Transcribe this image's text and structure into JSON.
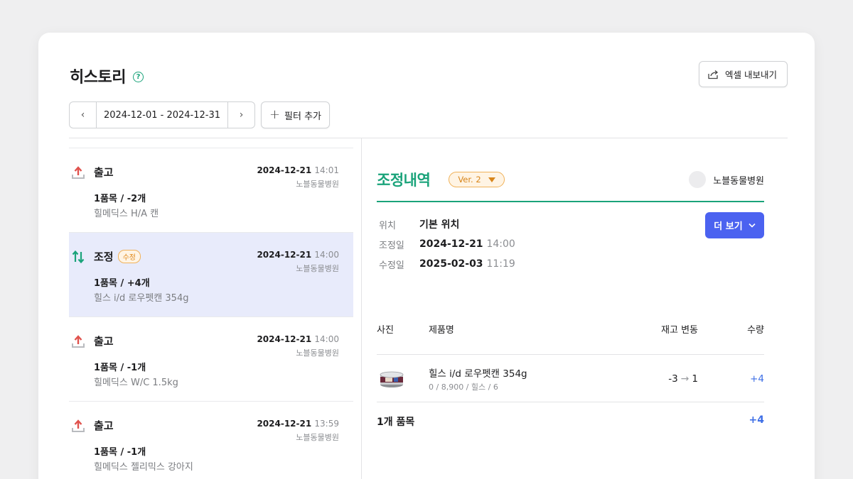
{
  "page": {
    "title": "히스토리",
    "export_label": "엑셀 내보내기",
    "date_range": "2024-12-01 - 2024-12-31",
    "filter_label": "필터 추가"
  },
  "history": [
    {
      "type": "출고",
      "kind": "out",
      "badge": "",
      "date": "2024-12-21",
      "time": "14:01",
      "place": "노블동물병원",
      "count": "1품목 / -2개",
      "product": "힐메딕스 H/A 캔",
      "selected": false
    },
    {
      "type": "조정",
      "kind": "adjust",
      "badge": "수정",
      "date": "2024-12-21",
      "time": "14:00",
      "place": "노블동물병원",
      "count": "1품목 / +4개",
      "product": "힐스 i/d 로우펫캔 354g",
      "selected": true
    },
    {
      "type": "출고",
      "kind": "out",
      "badge": "",
      "date": "2024-12-21",
      "time": "14:00",
      "place": "노블동물병원",
      "count": "1품목 / -1개",
      "product": "힐메딕스 W/C 1.5kg",
      "selected": false
    },
    {
      "type": "출고",
      "kind": "out",
      "badge": "",
      "date": "2024-12-21",
      "time": "13:59",
      "place": "노블동물병원",
      "count": "1품목 / -1개",
      "product": "힐메딕스 젤리믹스 강아지",
      "selected": false
    }
  ],
  "detail": {
    "title": "조정내역",
    "version": "Ver. 2",
    "hospital": "노블동물병원",
    "more_label": "더 보기",
    "location_label": "위치",
    "location": "기본 위치",
    "adjusted_label": "조정일",
    "adjusted_date": "2024-12-21",
    "adjusted_time": "14:00",
    "modified_label": "수정일",
    "modified_date": "2025-02-03",
    "modified_time": "11:19",
    "table_headers": {
      "photo": "사진",
      "name": "제품명",
      "stock": "재고 변동",
      "qty": "수량"
    },
    "rows": [
      {
        "name": "힐스 i/d 로우펫캔 354g",
        "sub": "0 / 8,900 / 힐스 / 6",
        "stock_from": "-3",
        "stock_to": "1",
        "qty": "+4"
      }
    ],
    "total_label": "1개 품목",
    "total_qty": "+4"
  },
  "icons": {
    "help": "help-circle-icon",
    "export": "share-export-icon",
    "prev": "chevron-left-icon",
    "next": "chevron-right-icon",
    "plus": "plus-icon",
    "out": "upload-arrow-icon",
    "adjust": "up-down-arrows-icon",
    "dropdown": "caret-down-icon",
    "chevron_down": "chevron-down-icon"
  },
  "colors": {
    "accent_green": "#1aa37a",
    "primary_blue": "#4b62f0",
    "selected_bg": "#e8ebfb",
    "out_red": "#e0524d",
    "badge_orange": "#e08a1e"
  }
}
